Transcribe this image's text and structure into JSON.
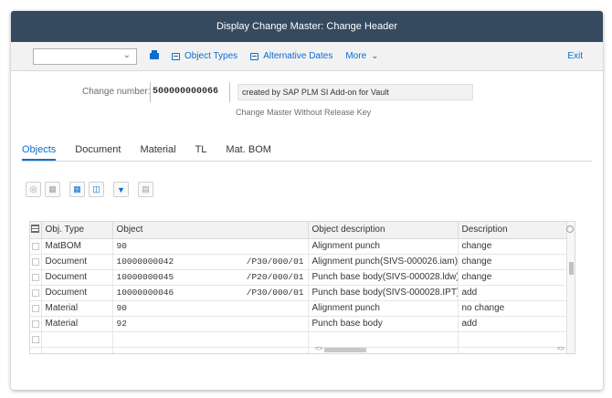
{
  "window": {
    "title": "Display Change Master: Change Header"
  },
  "toolbar": {
    "command_value": "",
    "print_icon": "printer-icon",
    "object_types_label": "Object Types",
    "alternative_dates_label": "Alternative Dates",
    "more_label": "More",
    "exit_label": "Exit"
  },
  "header": {
    "change_number_label": "Change number:",
    "change_number_value": "500000000066",
    "change_description": "created by SAP PLM SI Add-on for Vault",
    "release_key_text": "Change Master Without Release Key"
  },
  "tabs": [
    {
      "label": "Objects",
      "active": true
    },
    {
      "label": "Document",
      "active": false
    },
    {
      "label": "Material",
      "active": false
    },
    {
      "label": "TL",
      "active": false
    },
    {
      "label": "Mat. BOM",
      "active": false
    }
  ],
  "grid": {
    "columns": [
      "Obj. Type",
      "Object",
      "Object description",
      "Description"
    ],
    "rows": [
      {
        "type": "MatBOM",
        "object": "90",
        "path": "",
        "object_description": "Alignment punch",
        "description": "change"
      },
      {
        "type": "Document",
        "object": "10000000042",
        "path": "/P30/000/01",
        "object_description": "Alignment punch(SIVS-000026.iam)",
        "description": "change"
      },
      {
        "type": "Document",
        "object": "10000000045",
        "path": "/P20/000/01",
        "object_description": "Punch base body(SIVS-000028.ldw)",
        "description": "change"
      },
      {
        "type": "Document",
        "object": "10000000046",
        "path": "/P30/000/01",
        "object_description": "Punch base body(SIVS-000028.IPT)",
        "description": "add"
      },
      {
        "type": "Material",
        "object": "90",
        "path": "",
        "object_description": "Alignment punch",
        "description": "no change"
      },
      {
        "type": "Material",
        "object": "92",
        "path": "",
        "object_description": "Punch base body",
        "description": "add"
      },
      {
        "type": "",
        "object": "",
        "path": "",
        "object_description": "",
        "description": ""
      }
    ]
  },
  "colors": {
    "title_bar": "#354a5f",
    "link_blue": "#0a6ed1"
  }
}
